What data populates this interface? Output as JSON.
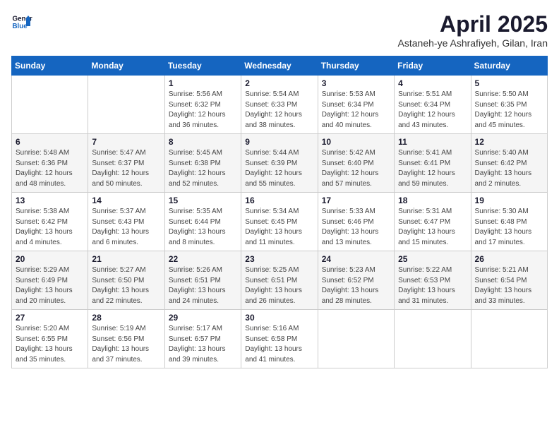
{
  "logo": {
    "line1": "General",
    "line2": "Blue"
  },
  "title": "April 2025",
  "subtitle": "Astaneh-ye Ashrafiyeh, Gilan, Iran",
  "header": {
    "colors": {
      "bg": "#1565c0"
    }
  },
  "weekdays": [
    "Sunday",
    "Monday",
    "Tuesday",
    "Wednesday",
    "Thursday",
    "Friday",
    "Saturday"
  ],
  "weeks": [
    [
      {
        "day": "",
        "info": ""
      },
      {
        "day": "",
        "info": ""
      },
      {
        "day": "1",
        "info": "Sunrise: 5:56 AM\nSunset: 6:32 PM\nDaylight: 12 hours\nand 36 minutes."
      },
      {
        "day": "2",
        "info": "Sunrise: 5:54 AM\nSunset: 6:33 PM\nDaylight: 12 hours\nand 38 minutes."
      },
      {
        "day": "3",
        "info": "Sunrise: 5:53 AM\nSunset: 6:34 PM\nDaylight: 12 hours\nand 40 minutes."
      },
      {
        "day": "4",
        "info": "Sunrise: 5:51 AM\nSunset: 6:34 PM\nDaylight: 12 hours\nand 43 minutes."
      },
      {
        "day": "5",
        "info": "Sunrise: 5:50 AM\nSunset: 6:35 PM\nDaylight: 12 hours\nand 45 minutes."
      }
    ],
    [
      {
        "day": "6",
        "info": "Sunrise: 5:48 AM\nSunset: 6:36 PM\nDaylight: 12 hours\nand 48 minutes."
      },
      {
        "day": "7",
        "info": "Sunrise: 5:47 AM\nSunset: 6:37 PM\nDaylight: 12 hours\nand 50 minutes."
      },
      {
        "day": "8",
        "info": "Sunrise: 5:45 AM\nSunset: 6:38 PM\nDaylight: 12 hours\nand 52 minutes."
      },
      {
        "day": "9",
        "info": "Sunrise: 5:44 AM\nSunset: 6:39 PM\nDaylight: 12 hours\nand 55 minutes."
      },
      {
        "day": "10",
        "info": "Sunrise: 5:42 AM\nSunset: 6:40 PM\nDaylight: 12 hours\nand 57 minutes."
      },
      {
        "day": "11",
        "info": "Sunrise: 5:41 AM\nSunset: 6:41 PM\nDaylight: 12 hours\nand 59 minutes."
      },
      {
        "day": "12",
        "info": "Sunrise: 5:40 AM\nSunset: 6:42 PM\nDaylight: 13 hours\nand 2 minutes."
      }
    ],
    [
      {
        "day": "13",
        "info": "Sunrise: 5:38 AM\nSunset: 6:42 PM\nDaylight: 13 hours\nand 4 minutes."
      },
      {
        "day": "14",
        "info": "Sunrise: 5:37 AM\nSunset: 6:43 PM\nDaylight: 13 hours\nand 6 minutes."
      },
      {
        "day": "15",
        "info": "Sunrise: 5:35 AM\nSunset: 6:44 PM\nDaylight: 13 hours\nand 8 minutes."
      },
      {
        "day": "16",
        "info": "Sunrise: 5:34 AM\nSunset: 6:45 PM\nDaylight: 13 hours\nand 11 minutes."
      },
      {
        "day": "17",
        "info": "Sunrise: 5:33 AM\nSunset: 6:46 PM\nDaylight: 13 hours\nand 13 minutes."
      },
      {
        "day": "18",
        "info": "Sunrise: 5:31 AM\nSunset: 6:47 PM\nDaylight: 13 hours\nand 15 minutes."
      },
      {
        "day": "19",
        "info": "Sunrise: 5:30 AM\nSunset: 6:48 PM\nDaylight: 13 hours\nand 17 minutes."
      }
    ],
    [
      {
        "day": "20",
        "info": "Sunrise: 5:29 AM\nSunset: 6:49 PM\nDaylight: 13 hours\nand 20 minutes."
      },
      {
        "day": "21",
        "info": "Sunrise: 5:27 AM\nSunset: 6:50 PM\nDaylight: 13 hours\nand 22 minutes."
      },
      {
        "day": "22",
        "info": "Sunrise: 5:26 AM\nSunset: 6:51 PM\nDaylight: 13 hours\nand 24 minutes."
      },
      {
        "day": "23",
        "info": "Sunrise: 5:25 AM\nSunset: 6:51 PM\nDaylight: 13 hours\nand 26 minutes."
      },
      {
        "day": "24",
        "info": "Sunrise: 5:23 AM\nSunset: 6:52 PM\nDaylight: 13 hours\nand 28 minutes."
      },
      {
        "day": "25",
        "info": "Sunrise: 5:22 AM\nSunset: 6:53 PM\nDaylight: 13 hours\nand 31 minutes."
      },
      {
        "day": "26",
        "info": "Sunrise: 5:21 AM\nSunset: 6:54 PM\nDaylight: 13 hours\nand 33 minutes."
      }
    ],
    [
      {
        "day": "27",
        "info": "Sunrise: 5:20 AM\nSunset: 6:55 PM\nDaylight: 13 hours\nand 35 minutes."
      },
      {
        "day": "28",
        "info": "Sunrise: 5:19 AM\nSunset: 6:56 PM\nDaylight: 13 hours\nand 37 minutes."
      },
      {
        "day": "29",
        "info": "Sunrise: 5:17 AM\nSunset: 6:57 PM\nDaylight: 13 hours\nand 39 minutes."
      },
      {
        "day": "30",
        "info": "Sunrise: 5:16 AM\nSunset: 6:58 PM\nDaylight: 13 hours\nand 41 minutes."
      },
      {
        "day": "",
        "info": ""
      },
      {
        "day": "",
        "info": ""
      },
      {
        "day": "",
        "info": ""
      }
    ]
  ]
}
